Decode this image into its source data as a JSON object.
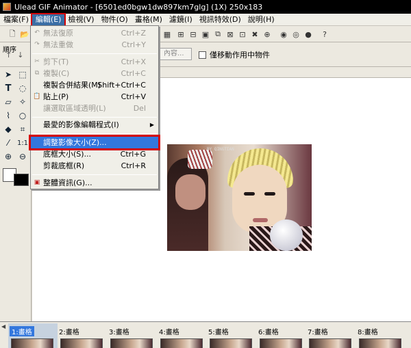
{
  "window": {
    "title": "Ulead GIF Animator - [6501ed0bgw1dw897km7glg] (1X) 250x183"
  },
  "menubar": {
    "items": [
      {
        "label": "檔案(F)"
      },
      {
        "label": "編輯(E)"
      },
      {
        "label": "檢視(V)"
      },
      {
        "label": "物件(O)"
      },
      {
        "label": "畫格(M)"
      },
      {
        "label": "濾鏡(I)"
      },
      {
        "label": "視訊特效(D)"
      },
      {
        "label": "說明(H)"
      }
    ]
  },
  "edit_menu": {
    "items": [
      {
        "label": "無法復原",
        "shortcut": "Ctrl+Z",
        "icon": "undo-icon"
      },
      {
        "label": "無法重做",
        "shortcut": "Ctrl+Y",
        "icon": "redo-icon"
      },
      {
        "label": "剪下(T)",
        "shortcut": "Ctrl+X",
        "icon": "scissors-icon"
      },
      {
        "label": "複製(C)",
        "shortcut": "Ctrl+C",
        "icon": "copy-icon"
      },
      {
        "label": "複製合併結果(M)",
        "shortcut": "Shift+Ctrl+C"
      },
      {
        "label": "貼上(P)",
        "shortcut": "Ctrl+V",
        "icon": "paste-icon"
      },
      {
        "label": "讓選取區域透明(L)",
        "shortcut": "Del"
      },
      {
        "label": "最愛的影像編輯程式(I)"
      },
      {
        "label": "調整影像大小(Z)..."
      },
      {
        "label": "底框大小(S)...",
        "shortcut": "Ctrl+G"
      },
      {
        "label": "剪裁底框(R)",
        "shortcut": "Ctrl+R"
      },
      {
        "label": "整體資訊(G)...",
        "icon": "info-icon"
      }
    ]
  },
  "toolbar2": {
    "order_label": "順序",
    "content_button": "內容...",
    "move_checkbox_label": "僅移動作用中物件"
  },
  "palette": {
    "zoom_label": "1:1"
  },
  "frames": {
    "items": [
      {
        "label": "1:畫格"
      },
      {
        "label": "2:畫格"
      },
      {
        "label": "3:畫格"
      },
      {
        "label": "4:畫格"
      },
      {
        "label": "5:畫格"
      },
      {
        "label": "6:畫格"
      },
      {
        "label": "7:畫格"
      },
      {
        "label": "8:畫格"
      }
    ],
    "selected_index": 0
  },
  "canvas": {
    "watermark": "BY QINGTIAN"
  },
  "colors": {
    "menu_highlight": "#3377dd",
    "annotation_red": "#d40000"
  }
}
